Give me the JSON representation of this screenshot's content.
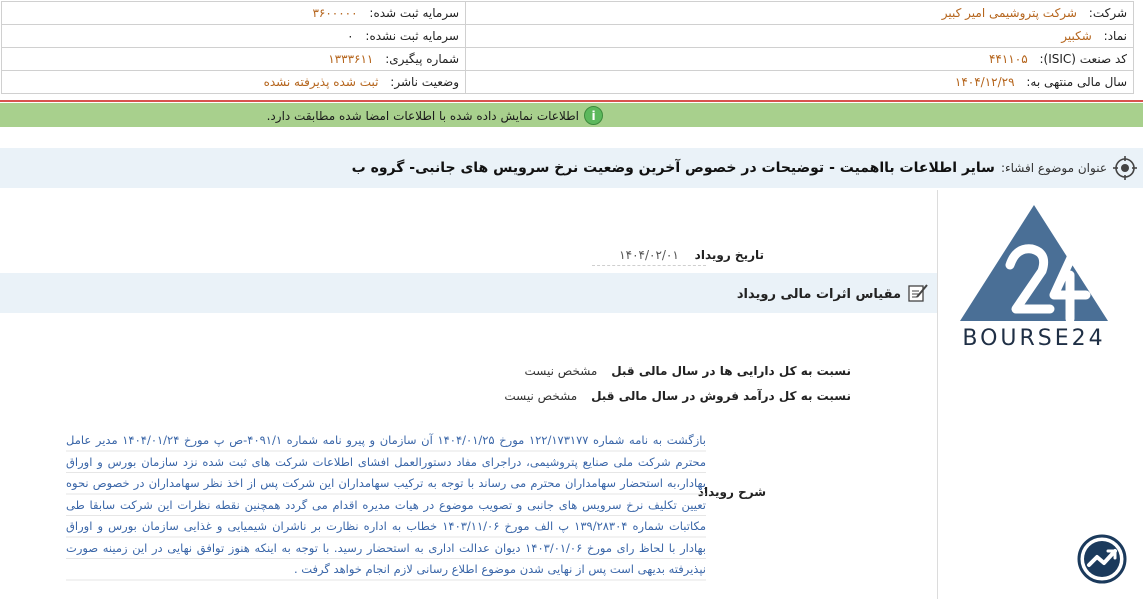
{
  "header": {
    "company_label": "شرکت:",
    "company_value": "شرکت پتروشیمی امیر کبیر",
    "capital_registered_label": "سرمایه ثبت شده:",
    "capital_registered_value": "۳۶۰۰۰۰۰",
    "symbol_label": "نماد:",
    "symbol_value": "شکبیر",
    "capital_unregistered_label": "سرمایه ثبت نشده:",
    "capital_unregistered_value": "۰",
    "isic_label": "کد صنعت (ISIC):",
    "isic_value": "۴۴۱۱۰۵",
    "tracking_label": "شماره پیگیری:",
    "tracking_value": "۱۳۳۳۶۱۱",
    "fiscal_year_label": "سال مالی منتهی به:",
    "fiscal_year_value": "۱۴۰۴/۱۲/۲۹",
    "publisher_status_label": "وضعیت ناشر:",
    "publisher_status_value": "ثبت شده پذیرفته نشده"
  },
  "notice": {
    "text": "اطلاعات نمایش داده شده با اطلاعات امضا شده مطابقت دارد."
  },
  "subject": {
    "label": "عنوان موضوع افشاء:",
    "value": "سایر اطلاعات بااهمیت - توضیحات در خصوص آخرین وضعیت نرخ سرویس های جانبی- گروه ب"
  },
  "event": {
    "date_label": "تاریخ رویداد",
    "date_value": "۱۴۰۴/۰۲/۰۱"
  },
  "section": {
    "title": "مقیاس اثرات مالی رویداد"
  },
  "metrics": [
    {
      "label": "نسبت به کل دارایی ها در سال مالی قبل",
      "value": "مشخص نیست"
    },
    {
      "label": "نسبت به کل درآمد فروش در سال مالی قبل",
      "value": "مشخص نیست"
    }
  ],
  "description": {
    "label": "شرح رویداد",
    "text": "بازگشت به نامه شماره ۱۲۲/۱۷۳۱۷۷ مورخ ۱۴۰۴/۰۱/۲۵ آن سازمان و پیرو نامه شماره ۴۰۹۱/۱-ص پ مورخ ۱۴۰۴/۰۱/۲۴ مدیر عامل محترم شرکت ملی صنایع پتروشیمی، دراجرای مفاد دستورالعمل افشای اطلاعات شرکت های ثبت شده نزد سازمان بورس و اوراق بهادار،به استحضار سهامداران محترم می رساند با توجه به ترکیب سهامداران این شرکت پس از اخذ نظر سهامداران در خصوص نحوه تعیین تکلیف نرخ سرویس های جانبی و تصویب موضوع در هیات مدیره اقدام می گردد همچنین نقطه نظرات این شرکت سابقا طی مکاتبات شماره ۱۳۹/۲۸۳۰۴ پ الف مورخ ۱۴۰۳/۱۱/۰۶ خطاب به اداره نظارت بر ناشران شیمیایی و غذایی سازمان بورس و اوراق بهادار با لحاظ رای مورخ ۱۴۰۳/۰۱/۰۶ دیوان عدالت اداری به استحضار رسید. با توجه به اینکه هنوز توافق نهایی در این زمینه صورت نپذیرفته بدیهی است پس از نهایی شدن موضوع اطلاع رسانی لازم انجام خواهد گرفت ."
  },
  "logo": {
    "text": "BOURSE24"
  },
  "colors": {
    "value_orange": "#b5651d",
    "notice_green": "#a8d08d",
    "panel_blue": "#eaf2f8",
    "desc_blue": "#3a66a8",
    "logo_blue": "#4a6f96",
    "rule_red": "#d9534f"
  },
  "icons": {
    "notice": "info-circle-icon",
    "subject": "target-icon",
    "section": "edit-note-icon",
    "badge": "chart-trend-icon"
  }
}
